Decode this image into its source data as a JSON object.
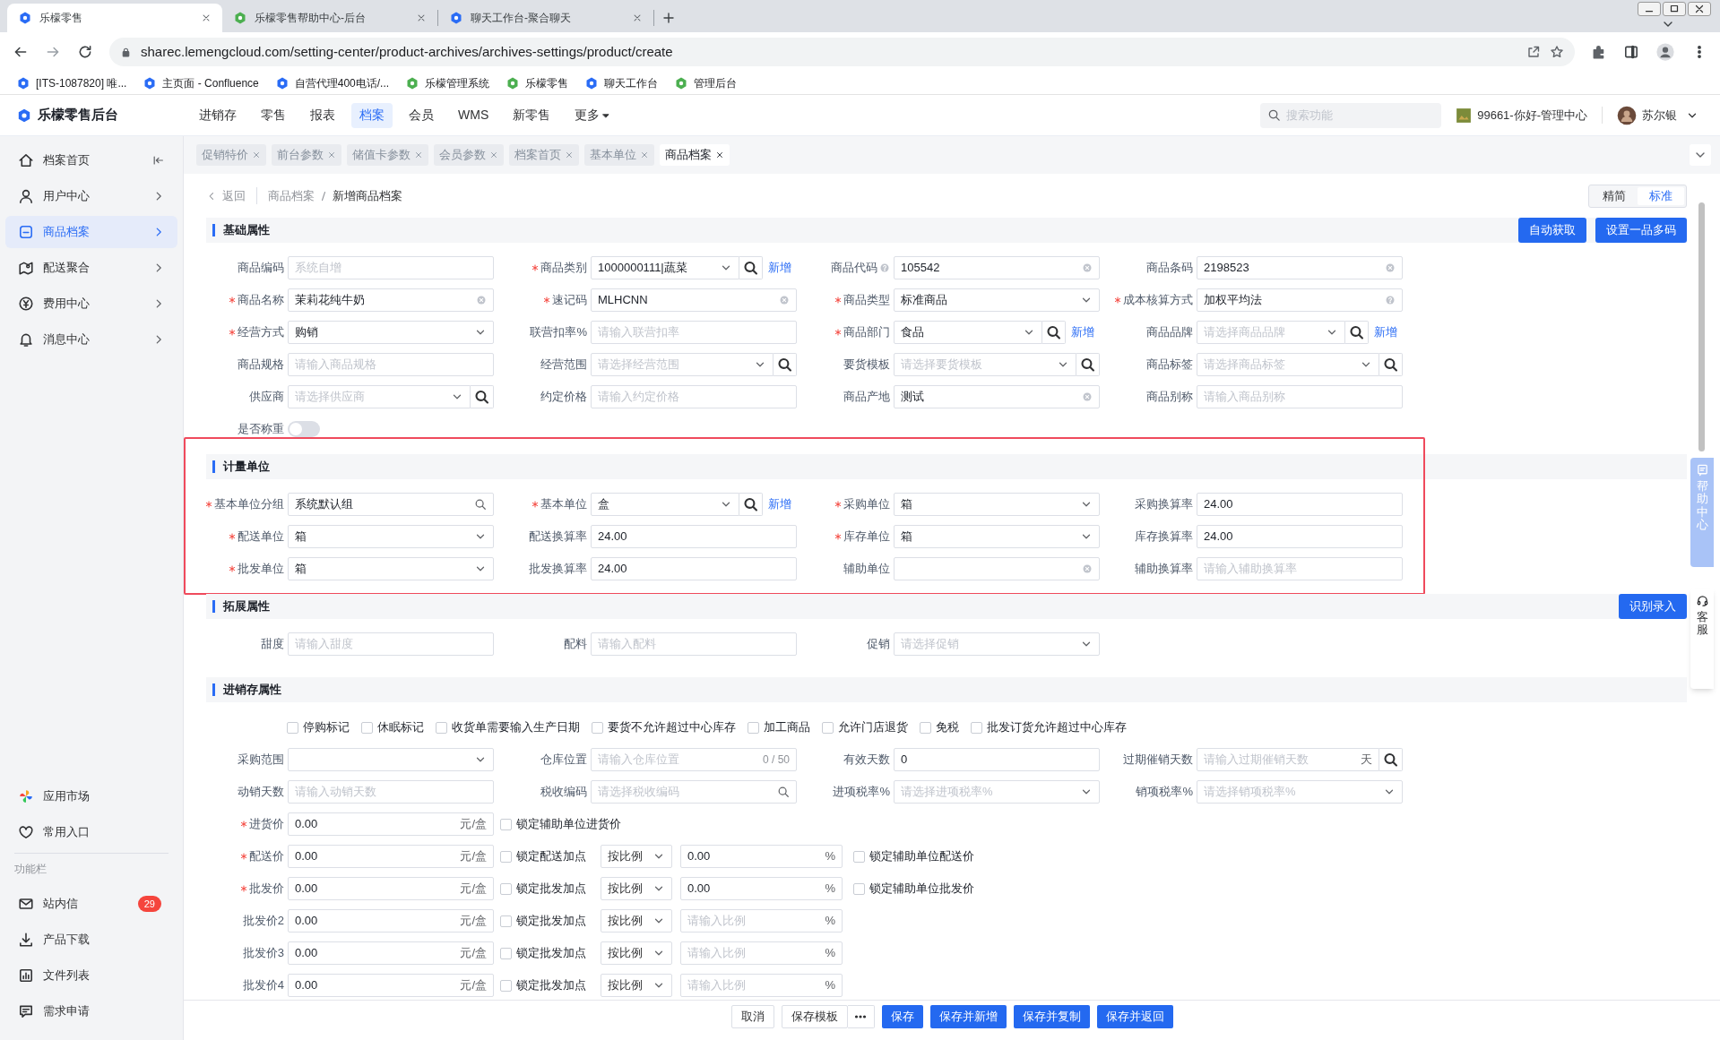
{
  "browser": {
    "tabs": [
      {
        "title": "乐檬零售",
        "selected": true
      },
      {
        "title": "乐檬零售帮助中心-后台",
        "selected": false
      },
      {
        "title": "聊天工作台-聚合聊天",
        "selected": false
      }
    ],
    "url": "sharec.lemengcloud.com/setting-center/product-archives/archives-settings/product/create",
    "bookmarks": [
      "[ITS-1087820] 唯...",
      "主页面 - Confluence",
      "自营代理400电话/...",
      "乐檬管理系统",
      "乐檬零售",
      "聊天工作台",
      "管理后台"
    ]
  },
  "app": {
    "logo": "乐檬零售后台",
    "nav": [
      {
        "label": "进销存",
        "selected": false,
        "has_menu": false
      },
      {
        "label": "零售",
        "selected": false,
        "has_menu": false
      },
      {
        "label": "报表",
        "selected": false,
        "has_menu": false
      },
      {
        "label": "档案",
        "selected": true,
        "has_menu": false
      },
      {
        "label": "会员",
        "selected": false,
        "has_menu": false
      },
      {
        "label": "WMS",
        "selected": false,
        "has_menu": false
      },
      {
        "label": "新零售",
        "selected": false,
        "has_menu": false
      },
      {
        "label": "更多",
        "selected": false,
        "has_menu": true
      }
    ],
    "search": {
      "placeholder": "搜索功能"
    },
    "store": "99661-你好-管理中心",
    "user": "苏尔银"
  },
  "sidebar": {
    "items": [
      {
        "label": "档案首页",
        "selected": false
      },
      {
        "label": "用户中心",
        "selected": false
      },
      {
        "label": "商品档案",
        "selected": true
      },
      {
        "label": "配送聚合",
        "selected": false
      },
      {
        "label": "费用中心",
        "selected": false
      },
      {
        "label": "消息中心",
        "selected": false
      }
    ],
    "bottom_items": [
      {
        "label": "应用市场"
      },
      {
        "label": "常用入口"
      }
    ],
    "section_title": "功能栏",
    "tool_items": [
      {
        "label": "站内信",
        "badge": "29"
      },
      {
        "label": "产品下载"
      },
      {
        "label": "文件列表"
      },
      {
        "label": "需求申请"
      }
    ]
  },
  "page_tabs": [
    {
      "label": "促销特价",
      "selected": false
    },
    {
      "label": "前台参数",
      "selected": false
    },
    {
      "label": "储值卡参数",
      "selected": false
    },
    {
      "label": "会员参数",
      "selected": false
    },
    {
      "label": "档案首页",
      "selected": false
    },
    {
      "label": "基本单位",
      "selected": false
    },
    {
      "label": "商品档案",
      "selected": true
    }
  ],
  "breadcrumb": {
    "back": "返回",
    "items": [
      "商品档案",
      "新增商品档案"
    ]
  },
  "view_toggle": [
    {
      "label": "精简",
      "selected": false
    },
    {
      "label": "标准",
      "selected": true
    }
  ],
  "sections": [
    {
      "title": "基础属性",
      "highlighted": false,
      "actions": [
        "自动获取",
        "设置一品多码"
      ],
      "rows": [
        [
          {
            "label": "商品编码",
            "required": false,
            "kind": "text",
            "placeholder": "系统自增"
          },
          {
            "label": "商品类别",
            "required": true,
            "kind": "select-lookup",
            "value": "1000000111|蔬菜",
            "add": "新增"
          },
          {
            "label": "商品代码",
            "required": false,
            "kind": "clear",
            "value": "105542",
            "label_help": true
          },
          {
            "label": "商品条码",
            "required": false,
            "kind": "clear",
            "value": "2198523"
          }
        ],
        [
          {
            "label": "商品名称",
            "required": true,
            "kind": "clear",
            "value": "茉莉花纯牛奶"
          },
          {
            "label": "速记码",
            "required": true,
            "kind": "clear",
            "value": "MLHCNN"
          },
          {
            "label": "商品类型",
            "required": true,
            "kind": "select",
            "value": "标准商品"
          },
          {
            "label": "成本核算方式",
            "required": true,
            "kind": "help",
            "value": "加权平均法"
          }
        ],
        [
          {
            "label": "经营方式",
            "required": true,
            "kind": "select",
            "value": "购销"
          },
          {
            "label": "联营扣率%",
            "required": false,
            "kind": "text",
            "placeholder": "请输入联营扣率"
          },
          {
            "label": "商品部门",
            "required": true,
            "kind": "select-lookup",
            "value": "食品",
            "add": "新增"
          },
          {
            "label": "商品品牌",
            "required": false,
            "kind": "select-lookup",
            "placeholder": "请选择商品品牌",
            "add": "新增"
          }
        ],
        [
          {
            "label": "商品规格",
            "required": false,
            "kind": "text",
            "placeholder": "请输入商品规格"
          },
          {
            "label": "经营范围",
            "required": false,
            "kind": "select-lookup",
            "placeholder": "请选择经营范围"
          },
          {
            "label": "要货模板",
            "required": false,
            "kind": "select-lookup",
            "placeholder": "请选择要货模板"
          },
          {
            "label": "商品标签",
            "required": false,
            "kind": "select-lookup",
            "placeholder": "请选择商品标签"
          }
        ],
        [
          {
            "label": "供应商",
            "required": false,
            "kind": "select-lookup",
            "placeholder": "请选择供应商"
          },
          {
            "label": "约定价格",
            "required": false,
            "kind": "text",
            "placeholder": "请输入约定价格"
          },
          {
            "label": "商品产地",
            "required": false,
            "kind": "clear",
            "value": "测试"
          },
          {
            "label": "商品别称",
            "required": false,
            "kind": "text",
            "placeholder": "请输入商品别称"
          }
        ]
      ],
      "switch": {
        "label": "是否称重",
        "on": false
      }
    },
    {
      "title": "计量单位",
      "highlighted": true,
      "rows": [
        [
          {
            "label": "基本单位分组",
            "required": true,
            "kind": "search",
            "value": "系统默认组"
          },
          {
            "label": "基本单位",
            "required": true,
            "kind": "select-lookup",
            "value": "盒",
            "add": "新增"
          },
          {
            "label": "采购单位",
            "required": true,
            "kind": "select",
            "value": "箱"
          },
          {
            "label": "采购换算率",
            "required": false,
            "kind": "text",
            "value": "24.00"
          }
        ],
        [
          {
            "label": "配送单位",
            "required": true,
            "kind": "select",
            "value": "箱"
          },
          {
            "label": "配送换算率",
            "required": false,
            "kind": "text",
            "value": "24.00"
          },
          {
            "label": "库存单位",
            "required": true,
            "kind": "select",
            "value": "箱"
          },
          {
            "label": "库存换算率",
            "required": false,
            "kind": "text",
            "value": "24.00"
          }
        ],
        [
          {
            "label": "批发单位",
            "required": true,
            "kind": "select",
            "value": "箱"
          },
          {
            "label": "批发换算率",
            "required": false,
            "kind": "text",
            "value": "24.00"
          },
          {
            "label": "辅助单位",
            "required": false,
            "kind": "clear"
          },
          {
            "label": "辅助换算率",
            "required": false,
            "kind": "text",
            "placeholder": "请输入辅助换算率"
          }
        ]
      ]
    },
    {
      "title": "拓展属性",
      "highlighted": false,
      "actions": [
        "识别录入"
      ],
      "rows": [
        [
          {
            "label": "甜度",
            "required": false,
            "kind": "text",
            "placeholder": "请输入甜度"
          },
          {
            "label": "配料",
            "required": false,
            "kind": "text",
            "placeholder": "请输入配料"
          },
          {
            "label": "促销",
            "required": false,
            "kind": "select",
            "placeholder": "请选择促销"
          }
        ]
      ]
    },
    {
      "title": "进销存属性",
      "highlighted": false,
      "flags": [
        {
          "label": "停购标记",
          "checked": false
        },
        {
          "label": "休眠标记",
          "checked": false
        },
        {
          "label": "收货单需要输入生产日期",
          "checked": false
        },
        {
          "label": "要货不允许超过中心库存",
          "checked": false
        },
        {
          "label": "加工商品",
          "checked": false
        },
        {
          "label": "允许门店退货",
          "checked": false
        },
        {
          "label": "免税",
          "checked": false
        },
        {
          "label": "批发订货允许超过中心库存",
          "checked": false
        }
      ],
      "rows": [
        [
          {
            "label": "采购范围",
            "required": false,
            "kind": "select"
          },
          {
            "label": "仓库位置",
            "required": false,
            "kind": "text",
            "placeholder": "请输入仓库位置",
            "counter": "0 / 50"
          },
          {
            "label": "有效天数",
            "required": false,
            "kind": "text",
            "value": "0"
          },
          {
            "label": "过期催销天数",
            "required": false,
            "kind": "text-lookup",
            "placeholder": "请输入过期催销天数",
            "unit": "天"
          }
        ],
        [
          {
            "label": "动销天数",
            "required": false,
            "kind": "text",
            "placeholder": "请输入动销天数"
          },
          {
            "label": "税收编码",
            "required": false,
            "kind": "search",
            "placeholder": "请选择税收编码"
          },
          {
            "label": "进项税率%",
            "required": false,
            "kind": "select",
            "placeholder": "请选择进项税率%"
          },
          {
            "label": "销项税率%",
            "required": false,
            "kind": "select",
            "placeholder": "请选择销项税率%"
          }
        ]
      ],
      "prices": [
        {
          "label": "进货价",
          "required": true,
          "value": "0.00",
          "unit": "元/盒",
          "lock": {
            "label": "锁定辅助单位进货价",
            "checked": false
          }
        },
        {
          "label": "配送价",
          "required": true,
          "value": "0.00",
          "unit": "元/盒",
          "lock": {
            "label": "锁定配送加点",
            "checked": false
          },
          "mode": "按比例",
          "ratio": {
            "value": "0.00",
            "unit": "%"
          },
          "aux_lock": {
            "label": "锁定辅助单位配送价",
            "checked": false
          }
        },
        {
          "label": "批发价",
          "required": true,
          "value": "0.00",
          "unit": "元/盒",
          "lock": {
            "label": "锁定批发加点",
            "checked": false
          },
          "mode": "按比例",
          "ratio": {
            "value": "0.00",
            "unit": "%"
          },
          "aux_lock": {
            "label": "锁定辅助单位批发价",
            "checked": false
          }
        },
        {
          "label": "批发价2",
          "required": false,
          "value": "0.00",
          "unit": "元/盒",
          "lock": {
            "label": "锁定批发加点",
            "checked": false
          },
          "mode": "按比例",
          "ratio": {
            "placeholder": "请输入比例",
            "unit": "%"
          }
        },
        {
          "label": "批发价3",
          "required": false,
          "value": "0.00",
          "unit": "元/盒",
          "lock": {
            "label": "锁定批发加点",
            "checked": false
          },
          "mode": "按比例",
          "ratio": {
            "placeholder": "请输入比例",
            "unit": "%"
          }
        },
        {
          "label": "批发价4",
          "required": false,
          "value": "0.00",
          "unit": "元/盒",
          "lock": {
            "label": "锁定批发加点",
            "checked": false
          },
          "mode": "按比例",
          "ratio": {
            "placeholder": "请输入比例",
            "unit": "%"
          }
        }
      ]
    }
  ],
  "side_widgets": [
    {
      "label": "帮助中心",
      "kind": "help"
    },
    {
      "label": "客服",
      "kind": "service"
    }
  ],
  "footer": {
    "buttons": [
      {
        "label": "取消",
        "kind": "default"
      },
      {
        "label": "保存模板",
        "kind": "default"
      },
      {
        "kind": "more"
      },
      {
        "label": "保存",
        "kind": "primary"
      },
      {
        "label": "保存并新增",
        "kind": "primary"
      },
      {
        "label": "保存并复制",
        "kind": "primary"
      },
      {
        "label": "保存并返回",
        "kind": "primary"
      }
    ]
  }
}
